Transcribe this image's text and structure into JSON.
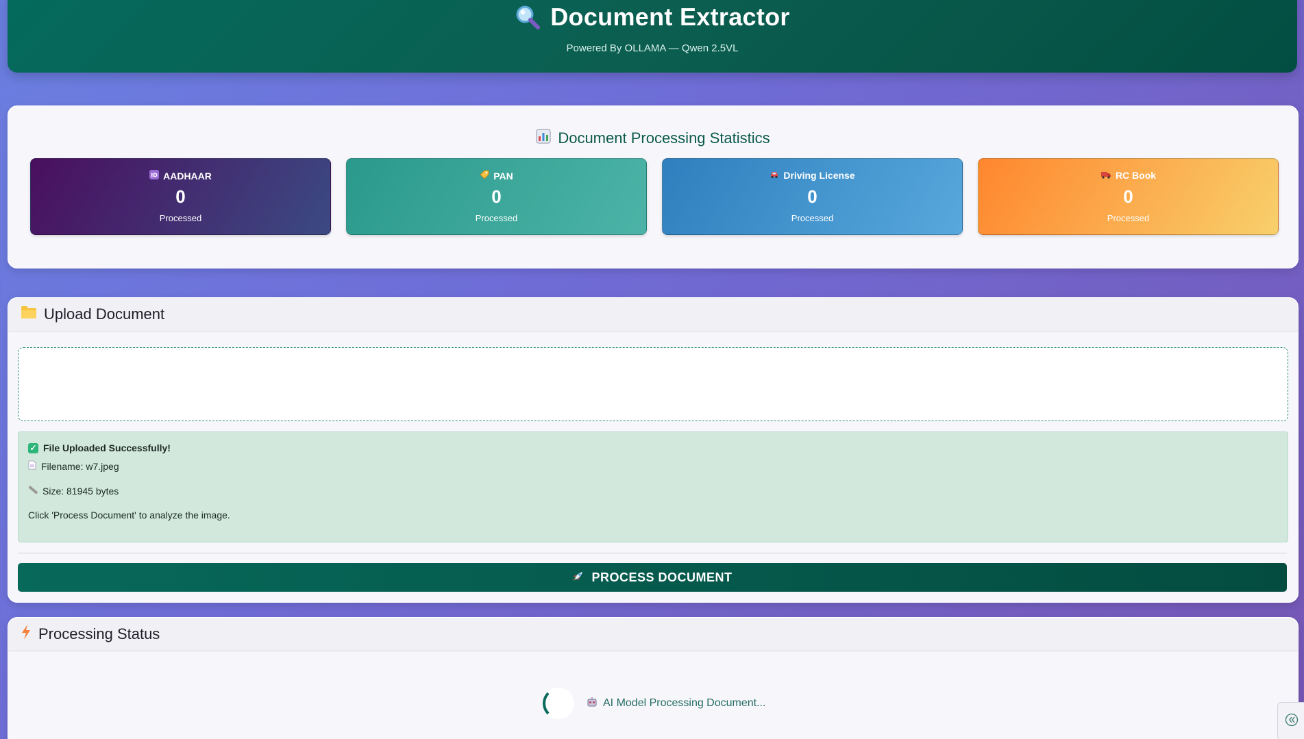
{
  "header": {
    "title": "Document Extractor",
    "subtitle": "Powered By OLLAMA — Qwen 2.5VL",
    "icon": "magnifier-icon"
  },
  "stats": {
    "title": "Document Processing Statistics",
    "icon": "bar-chart-icon",
    "items": [
      {
        "label": "AADHAAR",
        "count": "0",
        "sub": "Processed",
        "icon": "id-icon",
        "color": "#4a0f5f"
      },
      {
        "label": "PAN",
        "count": "0",
        "sub": "Processed",
        "icon": "tag-icon",
        "color": "#2a9a8c"
      },
      {
        "label": "Driving License",
        "count": "0",
        "sub": "Processed",
        "icon": "car-icon",
        "color": "#2f7fbe"
      },
      {
        "label": "RC Book",
        "count": "0",
        "sub": "Processed",
        "icon": "truck-icon",
        "color": "#ff862e"
      }
    ]
  },
  "upload": {
    "title": "Upload Document",
    "icon": "folder-icon",
    "success_title": "File Uploaded Successfully!",
    "filename": "Filename: w7.jpeg",
    "size": "Size: 81945 bytes",
    "hint": "Click 'Process Document' to analyze the image.",
    "button_label": "PROCESS DOCUMENT",
    "button_icon": "rocket-icon"
  },
  "status": {
    "title": "Processing Status",
    "icon": "lightning-icon",
    "loading_text": "AI Model Processing Document...",
    "loading_icon": "robot-icon"
  },
  "colors": {
    "accent": "#046a5c",
    "success_bg": "#d2e8dd"
  }
}
